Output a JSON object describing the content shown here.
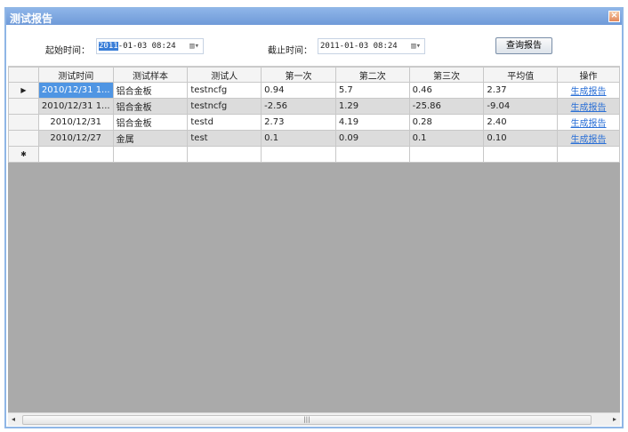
{
  "window": {
    "title": "测试报告",
    "close": "✕"
  },
  "filter": {
    "start_label": "起始时间：",
    "start_value_sel": "2011",
    "start_value_rest": "-01-03 08:24",
    "end_label": "截止时间：",
    "end_value": "2011-01-03 08:24",
    "calendar": "▥▾",
    "query_button": "查询报告"
  },
  "grid": {
    "columns": [
      "测试时间",
      "测试样本",
      "测试人",
      "第一次",
      "第二次",
      "第三次",
      "平均值",
      "操作"
    ],
    "rows": [
      [
        "2010/12/31 1...",
        "铝合金板",
        "testncfg",
        "0.94",
        "5.7",
        "0.46",
        "2.37",
        "生成报告"
      ],
      [
        "2010/12/31 1...",
        "铝合金板",
        "testncfg",
        "-2.56",
        "1.29",
        "-25.86",
        "-9.04",
        "生成报告"
      ],
      [
        "2010/12/31",
        "铝合金板",
        "testd",
        "2.73",
        "4.19",
        "0.28",
        "2.40",
        "生成报告"
      ],
      [
        "2010/12/27",
        "金属",
        "test",
        "0.1",
        "0.09",
        "0.1",
        "0.10",
        "生成报告"
      ]
    ],
    "current_marker": "▶",
    "new_row_marker": "✱"
  },
  "scrollbar": {
    "left": "◂",
    "right": "▸",
    "grip": "|||"
  }
}
